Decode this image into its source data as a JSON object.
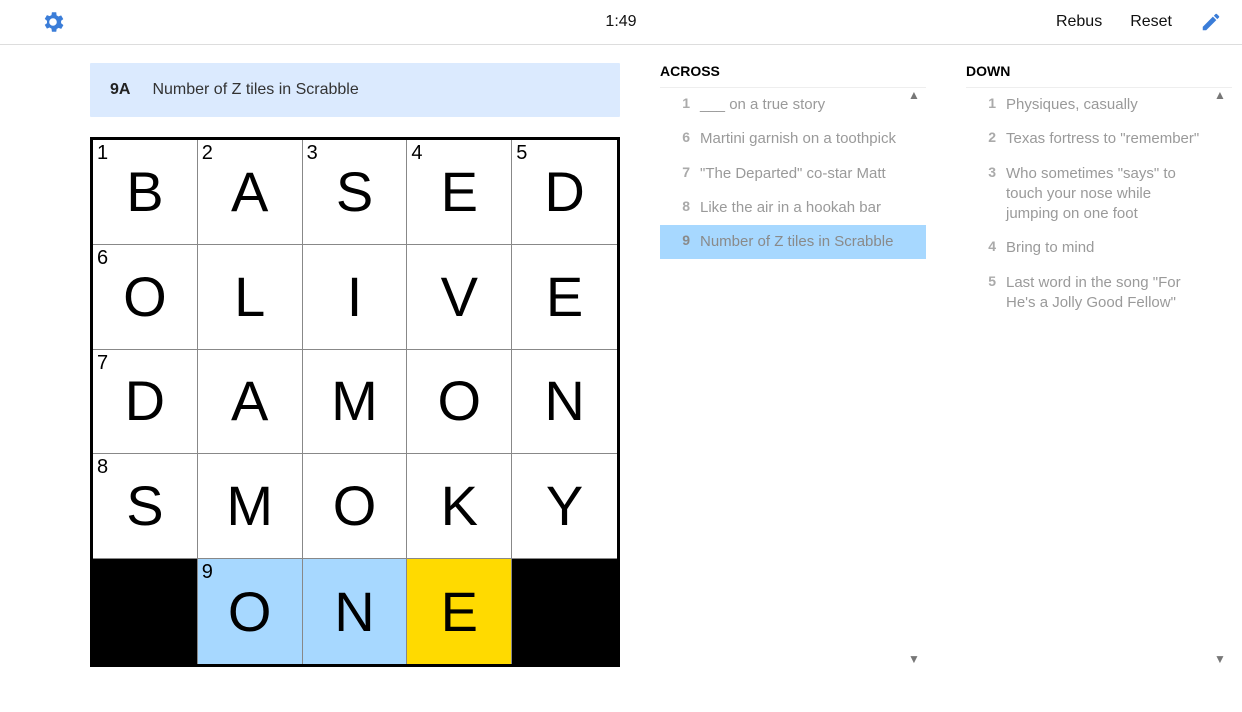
{
  "toolbar": {
    "timer": "1:49",
    "rebus": "Rebus",
    "reset": "Reset"
  },
  "clue_bar": {
    "num": "9A",
    "text": "Number of Z tiles in Scrabble"
  },
  "grid": [
    [
      {
        "n": "1",
        "l": "B"
      },
      {
        "n": "2",
        "l": "A"
      },
      {
        "n": "3",
        "l": "S"
      },
      {
        "n": "4",
        "l": "E"
      },
      {
        "n": "5",
        "l": "D"
      }
    ],
    [
      {
        "n": "6",
        "l": "O"
      },
      {
        "l": "L"
      },
      {
        "l": "I"
      },
      {
        "l": "V"
      },
      {
        "l": "E"
      }
    ],
    [
      {
        "n": "7",
        "l": "D"
      },
      {
        "l": "A"
      },
      {
        "l": "M"
      },
      {
        "l": "O"
      },
      {
        "l": "N"
      }
    ],
    [
      {
        "n": "8",
        "l": "S"
      },
      {
        "l": "M"
      },
      {
        "l": "O"
      },
      {
        "l": "K"
      },
      {
        "l": "Y"
      }
    ],
    [
      {
        "black": true
      },
      {
        "n": "9",
        "l": "O",
        "state": "sel"
      },
      {
        "l": "N",
        "state": "sel"
      },
      {
        "l": "E",
        "state": "cur"
      },
      {
        "black": true
      }
    ]
  ],
  "across": {
    "title": "ACROSS",
    "clues": [
      {
        "n": "1",
        "t": "___ on a true story"
      },
      {
        "n": "6",
        "t": "Martini garnish on a toothpick"
      },
      {
        "n": "7",
        "t": "\"The Departed\" co-star Matt"
      },
      {
        "n": "8",
        "t": "Like the air in a hookah bar"
      },
      {
        "n": "9",
        "t": "Number of Z tiles in Scrabble",
        "active": true
      }
    ]
  },
  "down": {
    "title": "DOWN",
    "clues": [
      {
        "n": "1",
        "t": "Physiques, casually"
      },
      {
        "n": "2",
        "t": "Texas fortress to \"remember\""
      },
      {
        "n": "3",
        "t": "Who sometimes \"says\" to touch your nose while jumping on one foot"
      },
      {
        "n": "4",
        "t": "Bring to mind",
        "marked": true
      },
      {
        "n": "5",
        "t": "Last word in the song \"For He's a Jolly Good Fellow\""
      }
    ]
  }
}
